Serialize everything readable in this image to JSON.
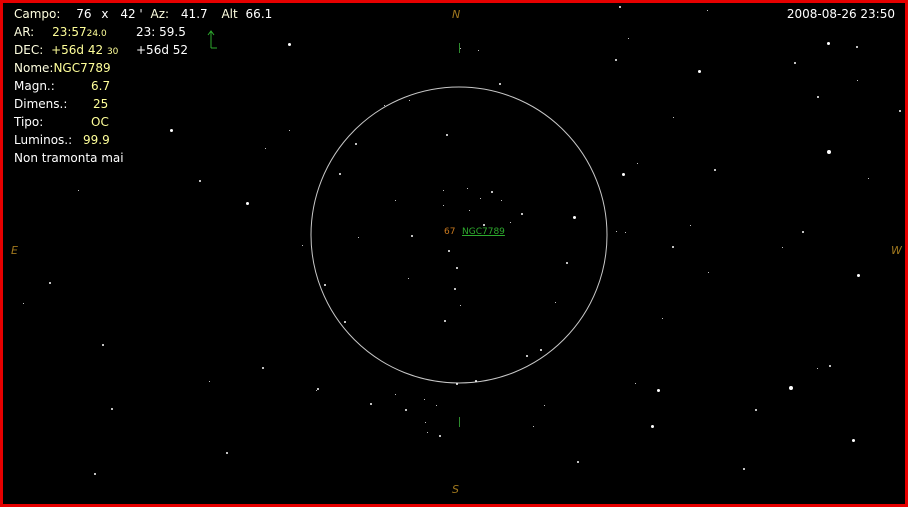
{
  "header": {
    "campo_label": "Campo:",
    "campo_w": "76",
    "campo_x": "x",
    "campo_h": "42 '",
    "az_label": "Az:",
    "az_value": "41.7",
    "alt_label": "Alt",
    "alt_value": "66.1",
    "datetime": "2008-08-26  23:50"
  },
  "coords": {
    "ar_label": "AR:",
    "ar_value": "23:57",
    "ar_small": "24.0",
    "ar_target": "23: 59.5",
    "dec_label": "DEC:",
    "dec_value": "+56d 42",
    "dec_small": "30",
    "dec_target": "+56d 52"
  },
  "object": {
    "nome_label": "Nome:",
    "nome_value": "NGC7789",
    "magn_label": "Magn.:",
    "magn_value": "6.7",
    "dimens_label": "Dimens.:",
    "dimens_value": "25",
    "tipo_label": "Tipo:",
    "tipo_value": "OC",
    "luminos_label": "Luminos.:",
    "luminos_value": "99.9",
    "note": "Non tramonta mai"
  },
  "cardinals": {
    "n": "N",
    "s": "S",
    "e": "E",
    "w": "W"
  },
  "target_label": {
    "mag": "67",
    "name": "NGC7789"
  },
  "colors": {
    "border": "#e60000",
    "background": "#000000",
    "circle": "#c8c8c8",
    "marker": "#2eaa2e",
    "cardinal": "#a0781e"
  }
}
